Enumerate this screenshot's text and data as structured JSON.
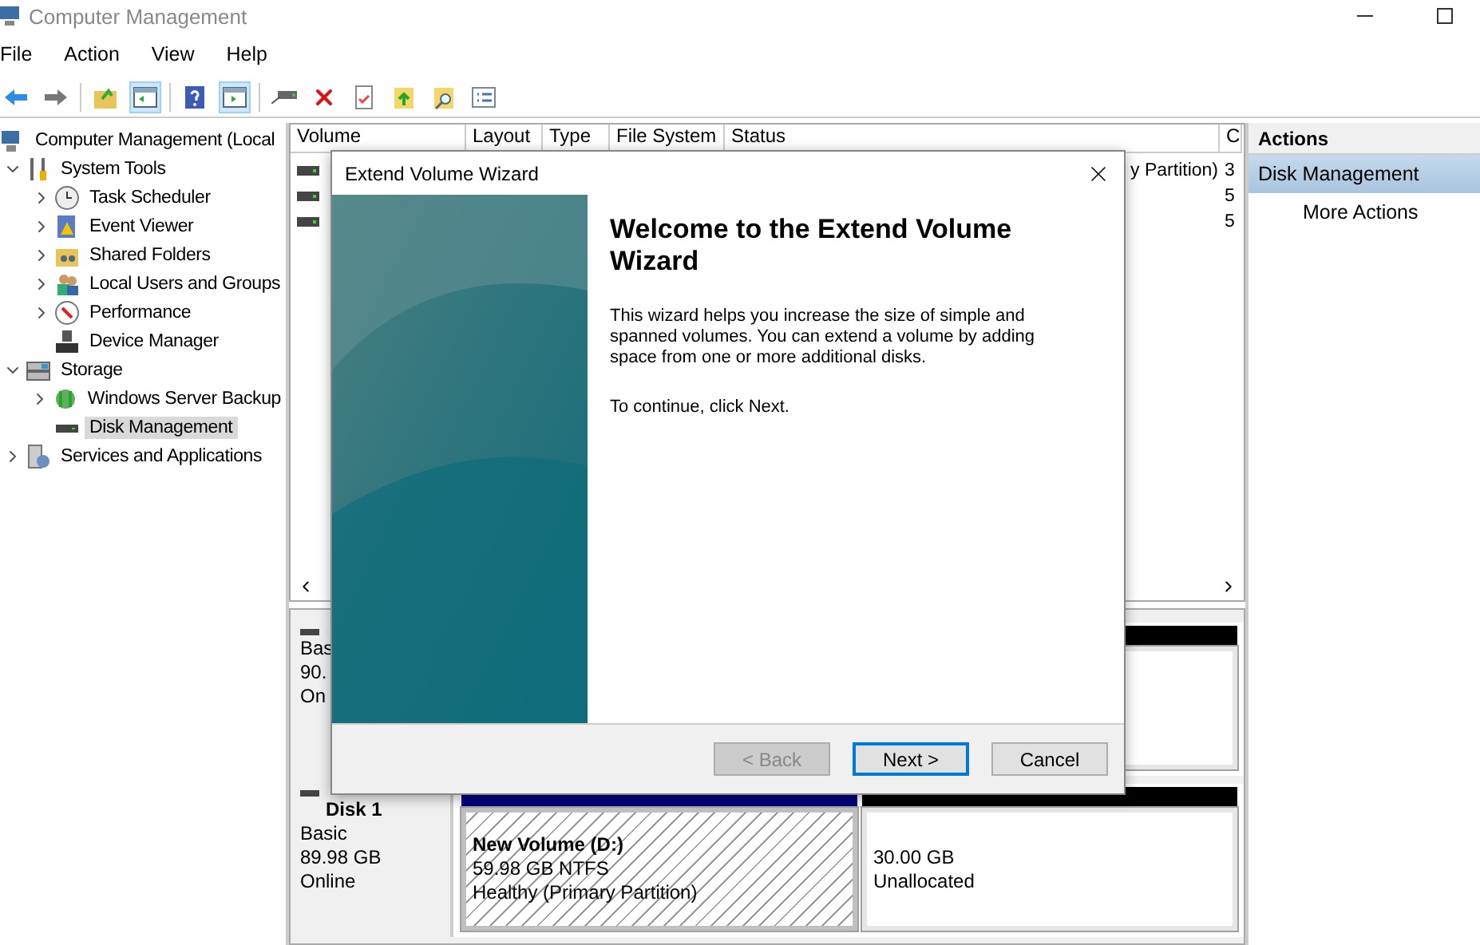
{
  "window": {
    "title": "Computer Management"
  },
  "menu": [
    "File",
    "Action",
    "View",
    "Help"
  ],
  "toolbar": [
    {
      "kind": "back",
      "pressed": false
    },
    {
      "kind": "forward",
      "pressed": false
    },
    {
      "kind": "sep"
    },
    {
      "kind": "up",
      "pressed": false
    },
    {
      "kind": "tree",
      "pressed": true
    },
    {
      "kind": "sep"
    },
    {
      "kind": "help",
      "pressed": false
    },
    {
      "kind": "pane",
      "pressed": true
    },
    {
      "kind": "sep"
    },
    {
      "kind": "connect",
      "pressed": false
    },
    {
      "kind": "delete",
      "pressed": false
    },
    {
      "kind": "props",
      "pressed": false
    },
    {
      "kind": "import",
      "pressed": false
    },
    {
      "kind": "find",
      "pressed": false
    },
    {
      "kind": "list",
      "pressed": false
    }
  ],
  "tree": [
    {
      "label": "Computer Management (Local",
      "selected": false,
      "children": [
        {
          "label": "System Tools",
          "expanded": true,
          "selected": false,
          "children": [
            {
              "label": "Task Scheduler",
              "expanded": false,
              "selected": false
            },
            {
              "label": "Event Viewer",
              "expanded": false,
              "selected": false
            },
            {
              "label": "Shared Folders",
              "expanded": false,
              "selected": false
            },
            {
              "label": "Local Users and Groups",
              "expanded": false,
              "selected": false
            },
            {
              "label": "Performance",
              "expanded": false,
              "selected": false
            },
            {
              "label": "Device Manager",
              "selected": false
            }
          ]
        },
        {
          "label": "Storage",
          "expanded": true,
          "selected": false,
          "children": [
            {
              "label": "Windows Server Backup",
              "expanded": false,
              "selected": false
            },
            {
              "label": "Disk Management",
              "selected": true
            }
          ]
        },
        {
          "label": "Services and Applications",
          "expanded": false,
          "selected": false
        }
      ]
    }
  ],
  "volume_table": {
    "columns": [
      "Volume",
      "Layout",
      "Type",
      "File System",
      "Status",
      "C"
    ],
    "rows": [
      {
        "status": "y Partition)",
        "capacity": "3"
      },
      {
        "capacity": "5"
      },
      {
        "capacity": "5"
      }
    ]
  },
  "disks": [
    {
      "lines": [
        "Bas",
        "90.",
        "On"
      ],
      "partitions": [
        {
          "kind": "unallocated",
          "selected": false
        }
      ]
    },
    {
      "name": "Disk 1",
      "lines": [
        "Basic",
        "89.98 GB",
        "Online"
      ],
      "partitions": [
        {
          "kind": "primary",
          "selected": true,
          "title": "New Volume  (D:)",
          "lines": [
            "59.98 GB NTFS",
            "Healthy (Primary Partition)"
          ]
        },
        {
          "kind": "unallocated",
          "selected": false,
          "lines": [
            "30.00 GB",
            "Unallocated"
          ]
        }
      ]
    }
  ],
  "actions": {
    "title": "Actions",
    "section": "Disk Management",
    "items": [
      "More Actions"
    ]
  },
  "dialog": {
    "title": "Extend Volume Wizard",
    "heading": "Welcome to the Extend Volume Wizard",
    "paragraphs": [
      "This wizard helps you increase the size of simple and spanned volumes. You can extend a volume  by adding space from one or more additional disks.",
      "To continue, click Next."
    ],
    "buttons": [
      {
        "label": "< Back",
        "disabled": true,
        "default": false
      },
      {
        "label": "Next >",
        "disabled": false,
        "default": true
      },
      {
        "label": "Cancel",
        "disabled": false,
        "default": false
      }
    ]
  }
}
